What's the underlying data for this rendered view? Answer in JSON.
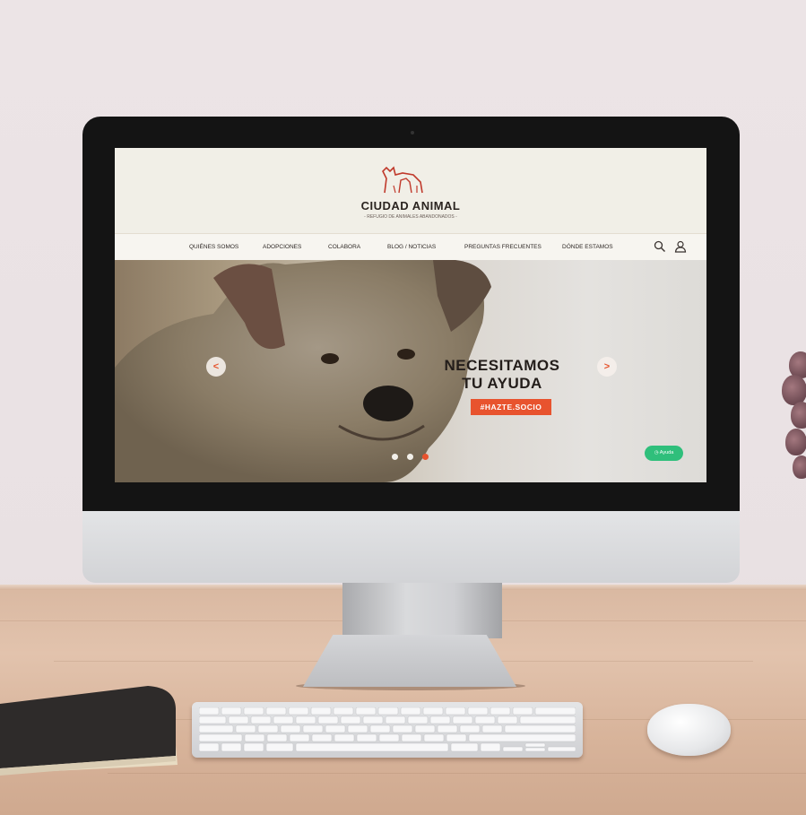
{
  "site": {
    "brand": "CIUDAD ANIMAL",
    "tagline": "- REFUGIO DE ANIMALES ABANDONADOS -",
    "logo_icon": "cat-dog-logo-icon",
    "brand_color": "#c0392b"
  },
  "nav": {
    "items": [
      {
        "label": "QUIÉNES SOMOS"
      },
      {
        "label": "ADOPCIONES"
      },
      {
        "label": "COLABORA"
      },
      {
        "label": "BLOG / NOTICIAS"
      },
      {
        "label": "PREGUNTAS FRECUENTES"
      },
      {
        "label": "DÓNDE ESTAMOS"
      }
    ],
    "search_icon": "search-icon",
    "account_icon": "user-icon"
  },
  "hero": {
    "headline_line1": "NECESITAMOS",
    "headline_line2": "TU AYUDA",
    "cta_label": "#HAZTE.SOCIO",
    "prev_label": "<",
    "next_label": ">",
    "slides_total": 3,
    "active_slide": 3,
    "accent_color": "#e8532e"
  },
  "help": {
    "label": "Ayuda",
    "icon": "clock-icon",
    "color": "#2fbf7b"
  }
}
